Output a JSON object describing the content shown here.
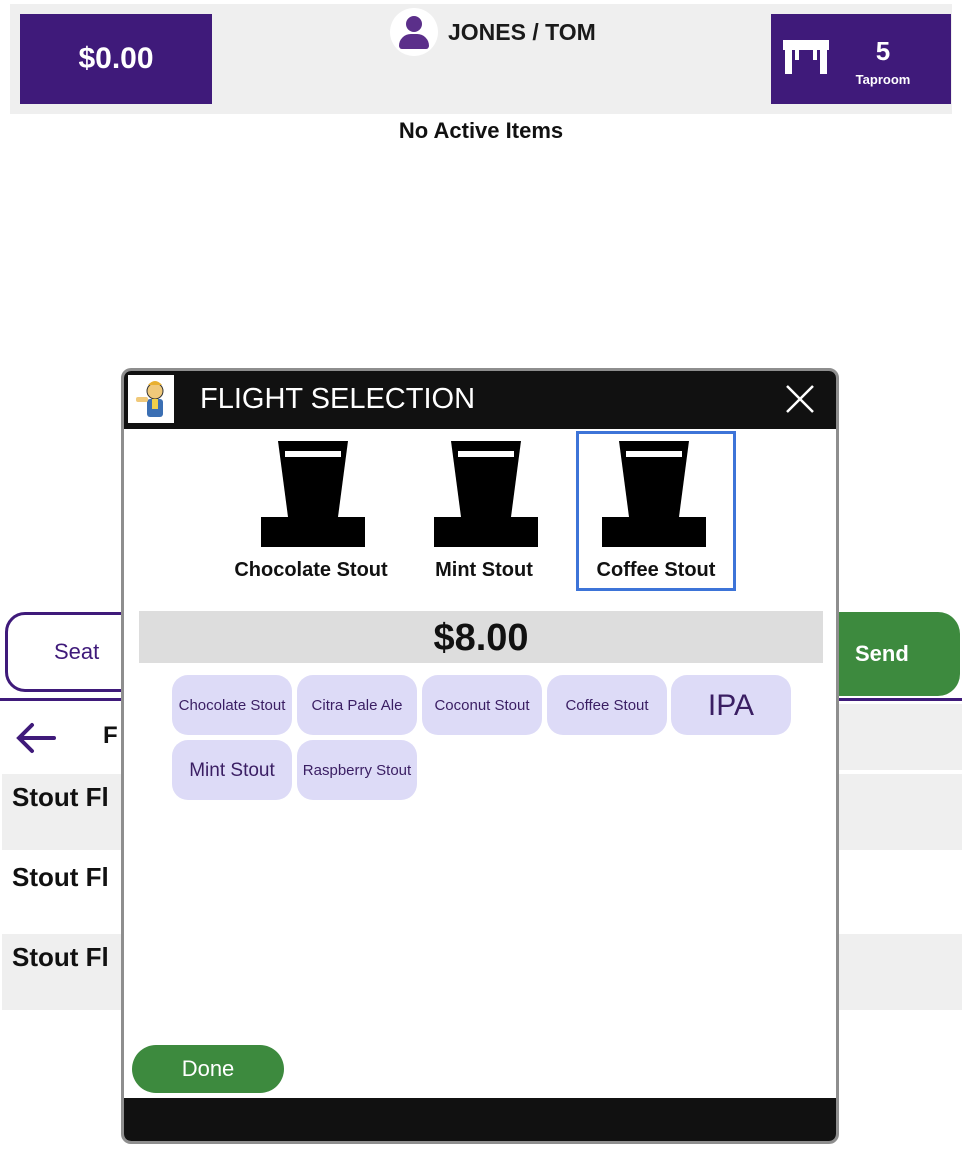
{
  "header": {
    "total": "$0.00",
    "customer_name": "JONES / TOM",
    "table_number": "5",
    "table_area": "Taproom"
  },
  "order": {
    "empty_message": "No Active Items"
  },
  "actions": {
    "seat_label": "Seat",
    "send_label": "Send"
  },
  "menu": {
    "crumb_initial": "F",
    "rows": [
      "Stout Fl",
      "Stout Fl",
      "Stout Fl"
    ]
  },
  "modal": {
    "title": "FLIGHT SELECTION",
    "glasses": [
      {
        "label": "Chocolate Stout",
        "selected": false
      },
      {
        "label": "Mint Stout",
        "selected": false
      },
      {
        "label": "Coffee Stout",
        "selected": true
      }
    ],
    "price": "$8.00",
    "options": [
      "Chocolate Stout",
      "Citra Pale Ale",
      "Coconut Stout",
      "Coffee Stout",
      "IPA",
      "Mint Stout",
      "Raspberry Stout"
    ],
    "done_label": "Done"
  },
  "colors": {
    "brand": "#3f1a7a",
    "accent_green": "#3d8a3e",
    "selection": "#3d74d8",
    "chip_bg": "#dddbf7"
  },
  "icons": [
    "user-icon",
    "table-icon",
    "back-arrow-icon",
    "close-icon",
    "beer-glass-icon",
    "app-logo"
  ]
}
